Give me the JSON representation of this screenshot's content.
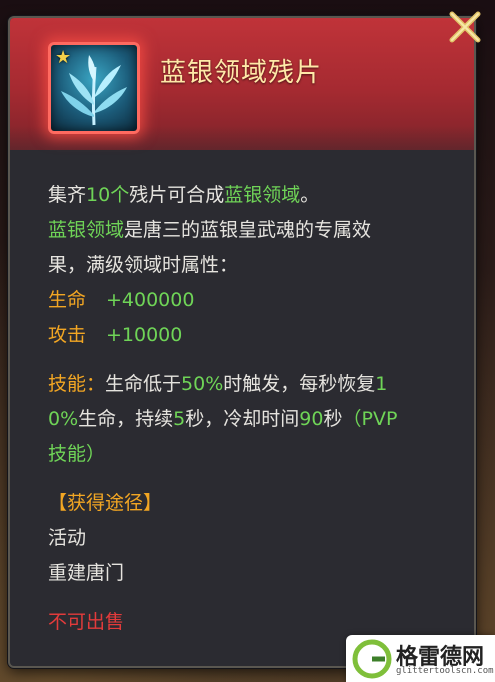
{
  "item": {
    "title": "蓝银领域残片",
    "icon": "blue-silver-grass-icon"
  },
  "description": {
    "line1": {
      "a": "集齐",
      "b": "10个",
      "c": "残片可合成",
      "d": "蓝银领域",
      "e": "。"
    },
    "line2": {
      "a": "蓝银领域",
      "b": "是唐三的蓝银皇武魂的专属效"
    },
    "line3": "果，满级领域时属性：",
    "attrs": [
      {
        "label": "生命",
        "value": "+400000"
      },
      {
        "label": "攻击",
        "value": "+10000"
      }
    ],
    "skill": {
      "label": "技能：",
      "t1": "生命低于",
      "n1": "50%",
      "t2": "时触发，每秒恢复",
      "n2a": "1",
      "n2b": "0%",
      "t3": "生命，持续",
      "n3": "5",
      "t4": "秒，冷却时间",
      "n4": "90",
      "t5": "秒",
      "tag_a": "（PVP",
      "tag_b": "技能）"
    }
  },
  "obtain": {
    "heading": "【获得途径】",
    "items": [
      "活动",
      "重建唐门"
    ]
  },
  "status": "不可出售",
  "watermark": {
    "text": "格雷德网",
    "sub": "glittertoolscn.com"
  },
  "colors": {
    "header": "#b02c33",
    "title": "#ffe9a8",
    "green": "#6fd457",
    "orange": "#f2a623",
    "red": "#e23b3b",
    "close": "#e2c46a"
  }
}
